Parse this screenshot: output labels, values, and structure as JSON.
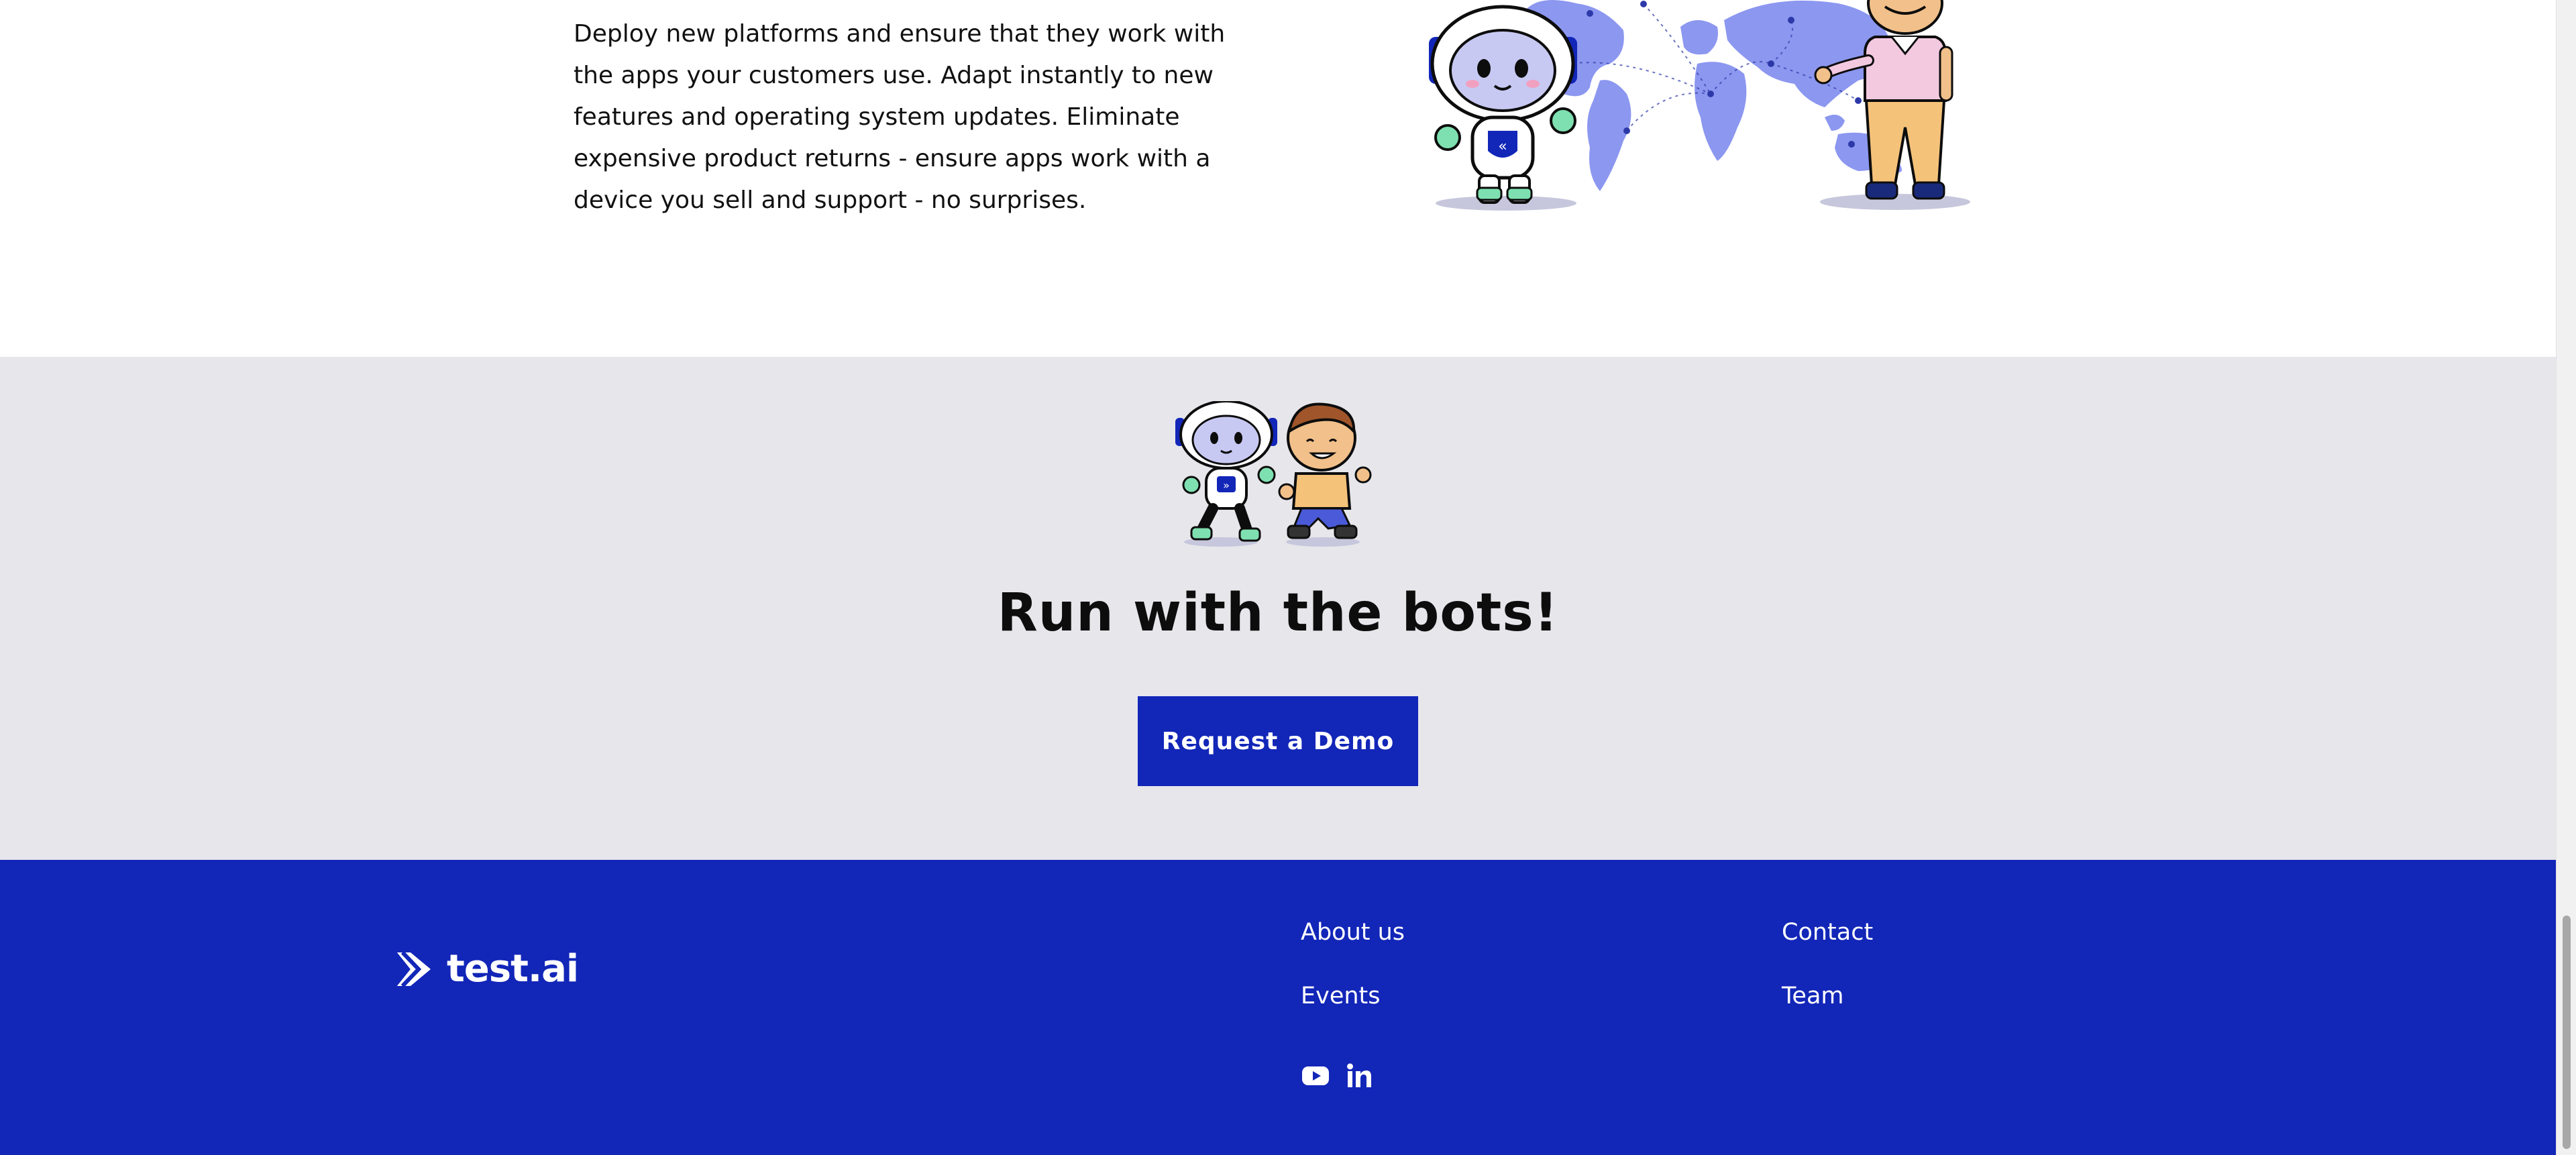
{
  "intro": {
    "paragraph": "Deploy new platforms and ensure that they work with the apps your customers use. Adapt instantly to new features and operating system updates. Eliminate expensive product returns - ensure apps work with a device you sell and support - no surprises."
  },
  "cta": {
    "title": "Run with the bots!",
    "button_label": "Request a Demo"
  },
  "footer": {
    "logo_text": "test.ai",
    "links": {
      "about": "About us",
      "events": "Events",
      "contact": "Contact",
      "team": "Team"
    },
    "social": [
      "youtube-icon",
      "linkedin-icon"
    ]
  },
  "colors": {
    "brand_blue": "#1226b8",
    "cta_background": "#e6e6eb",
    "map_blue": "#8c97f0"
  }
}
